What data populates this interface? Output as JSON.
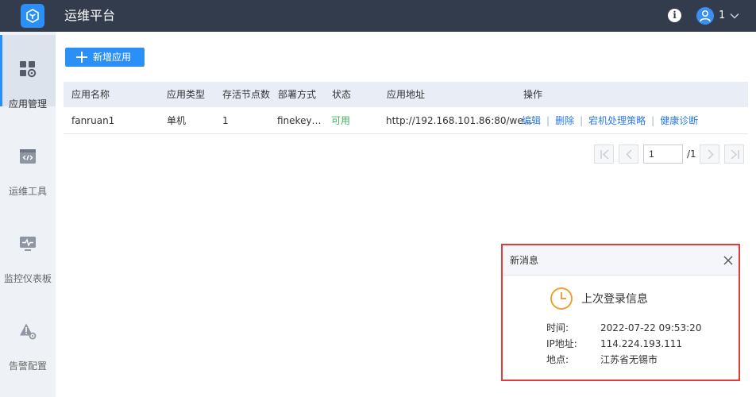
{
  "header": {
    "app_title": "运维平台",
    "user_name": "1",
    "logo_icon": "cube-icon",
    "info_icon": "info-icon",
    "user_icon": "user-icon"
  },
  "sidebar": {
    "items": [
      {
        "label": "应用管理",
        "icon": "grid-gear-icon",
        "active": true
      },
      {
        "label": "运维工具",
        "icon": "code-window-icon",
        "active": false
      },
      {
        "label": "监控仪表板",
        "icon": "monitor-pulse-icon",
        "active": false
      },
      {
        "label": "告警配置",
        "icon": "warning-gear-icon",
        "active": false
      }
    ]
  },
  "toolbar": {
    "add_label": "新增应用"
  },
  "table": {
    "headers": [
      "应用名称",
      "应用类型",
      "存活节点数",
      "部署方式",
      "状态",
      "应用地址",
      "操作"
    ],
    "rows": [
      {
        "name": "fanruan1",
        "type": "单机",
        "alive_nodes": "1",
        "deploy": "finekey…",
        "status": "可用",
        "address": "http://192.168.101.86:80/we…",
        "ops": [
          "编辑",
          "删除",
          "宕机处理策略",
          "健康诊断"
        ]
      }
    ],
    "separator": "|"
  },
  "pagination": {
    "current_page": "1",
    "total_label": "/1"
  },
  "notice": {
    "title": "新消息",
    "subtitle": "上次登录信息",
    "time_label": "时间:",
    "time_value": "2022-07-22 09:53:20",
    "ip_label": "IP地址:",
    "ip_value": "114.224.193.111",
    "location_label": "地点:",
    "location_value": "江苏省无锡市"
  },
  "colors": {
    "header_bg": "#333c4d",
    "accent": "#2a8ff7",
    "status_ok": "#3fb05f",
    "link": "#2a7ae2",
    "highlight_border": "#e23b3b"
  }
}
